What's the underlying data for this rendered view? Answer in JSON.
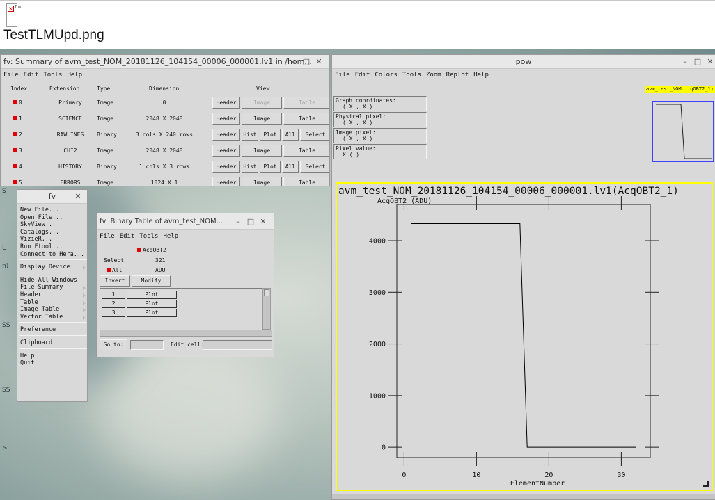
{
  "doc": {
    "filename": "TestTLMUpd.png",
    "broken_image_letters": "The"
  },
  "summary_window": {
    "title": "fv: Summary of avm_test_NOM_20181126_104154_00006_000001.lv1 in /hom...",
    "menu": [
      "File",
      "Edit",
      "Tools",
      "Help"
    ],
    "headers": {
      "index": "Index",
      "extension": "Extension",
      "type": "Type",
      "dimension": "Dimension",
      "view": "View"
    },
    "rows": [
      {
        "index": "0",
        "extension": "Primary",
        "type": "Image",
        "dimension": "0",
        "buttons": [
          "Header",
          "Image",
          "Table"
        ],
        "disabled": [
          false,
          true,
          true
        ]
      },
      {
        "index": "1",
        "extension": "SCIENCE",
        "type": "Image",
        "dimension": "2048 X 2048",
        "buttons": [
          "Header",
          "Image",
          "Table"
        ],
        "disabled": [
          false,
          false,
          false
        ]
      },
      {
        "index": "2",
        "extension": "RAWLINES",
        "type": "Binary",
        "dimension": "3 cols X 240 rows",
        "buttons": [
          "Header",
          "Hist",
          "Plot",
          "All",
          "Select"
        ],
        "disabled": [
          false,
          false,
          false,
          false,
          false
        ]
      },
      {
        "index": "3",
        "extension": "CHI2",
        "type": "Image",
        "dimension": "2048 X 2048",
        "buttons": [
          "Header",
          "Image",
          "Table"
        ],
        "disabled": [
          false,
          false,
          false
        ]
      },
      {
        "index": "4",
        "extension": "HISTORY",
        "type": "Binary",
        "dimension": "1 cols X 3 rows",
        "buttons": [
          "Header",
          "Hist",
          "Plot",
          "All",
          "Select"
        ],
        "disabled": [
          false,
          false,
          false,
          false,
          false
        ]
      },
      {
        "index": "5",
        "extension": "ERRORS",
        "type": "Image",
        "dimension": "1024 X 1",
        "buttons": [
          "Header",
          "Image",
          "Table"
        ],
        "disabled": [
          false,
          false,
          false
        ]
      }
    ]
  },
  "fv_menu": {
    "title": "fv",
    "groups": [
      [
        "New File...",
        "Open File...",
        "SkyView...",
        "Catalogs...",
        "VizieR...",
        "Run Ftool...",
        "Connect to Hera..."
      ],
      [
        "Display Device"
      ],
      [
        "Hide All Windows",
        "File Summary",
        "Header",
        "Table",
        "Image Table",
        "Vector Table"
      ],
      [
        "Preference"
      ],
      [
        "Clipboard"
      ],
      [
        "Help",
        "Quit"
      ]
    ],
    "submenus": [
      "Display Device",
      "File Summary",
      "Header",
      "Table",
      "Image Table",
      "Vector Table"
    ]
  },
  "binary_window": {
    "title": "fv: Binary Table of avm_test_NOM...",
    "menu": [
      "File",
      "Edit",
      "Tools",
      "Help"
    ],
    "column_name": "AcqOBT2",
    "select_label": "Select",
    "select_value": "321",
    "all_label": "All",
    "unit": "ADU",
    "invert_label": "Invert",
    "modify_label": "Modify",
    "rows": [
      {
        "num": "1",
        "btn": "Plot"
      },
      {
        "num": "2",
        "btn": "Plot"
      },
      {
        "num": "3",
        "btn": "Plot"
      }
    ],
    "goto_label": "Go to:",
    "editcell_label": "Edit cell:"
  },
  "pow_window": {
    "title": "pow",
    "menu": [
      "File",
      "Edit",
      "Colors",
      "Tools",
      "Zoom",
      "Replot",
      "Help"
    ],
    "graph_tag": "avm_test_NOM...qOBT2_1)",
    "coords": [
      {
        "label": "Graph coordinates:",
        "value": "( X , X )"
      },
      {
        "label": "Physical pixel:",
        "value": "( X , X )"
      },
      {
        "label": "Image pixel:",
        "value": "( X , X )"
      },
      {
        "label": "Pixel value:",
        "value": "X ( )"
      }
    ]
  },
  "chart_data": {
    "type": "line",
    "title": "avm_test_NOM_20181126_104154_00006_000001.lv1(AcqOBT2_1)",
    "xlabel": "ElementNumber",
    "ylabel": "AcqOBT2 (ADU)",
    "xlim": [
      -1,
      34
    ],
    "ylim": [
      -200,
      4700
    ],
    "xticks": [
      0,
      10,
      20,
      30
    ],
    "yticks": [
      0,
      1000,
      2000,
      3000,
      4000
    ],
    "series": [
      {
        "x": [
          1,
          16,
          17,
          32
        ],
        "y": [
          4330,
          4330,
          0,
          0
        ]
      }
    ],
    "colors": {
      "frame": "#ffff00",
      "line": "#000000"
    }
  },
  "colors": {
    "index_marker": "#e00000",
    "plot_frame": "#ffff00",
    "preview_border": "#4040ff"
  }
}
